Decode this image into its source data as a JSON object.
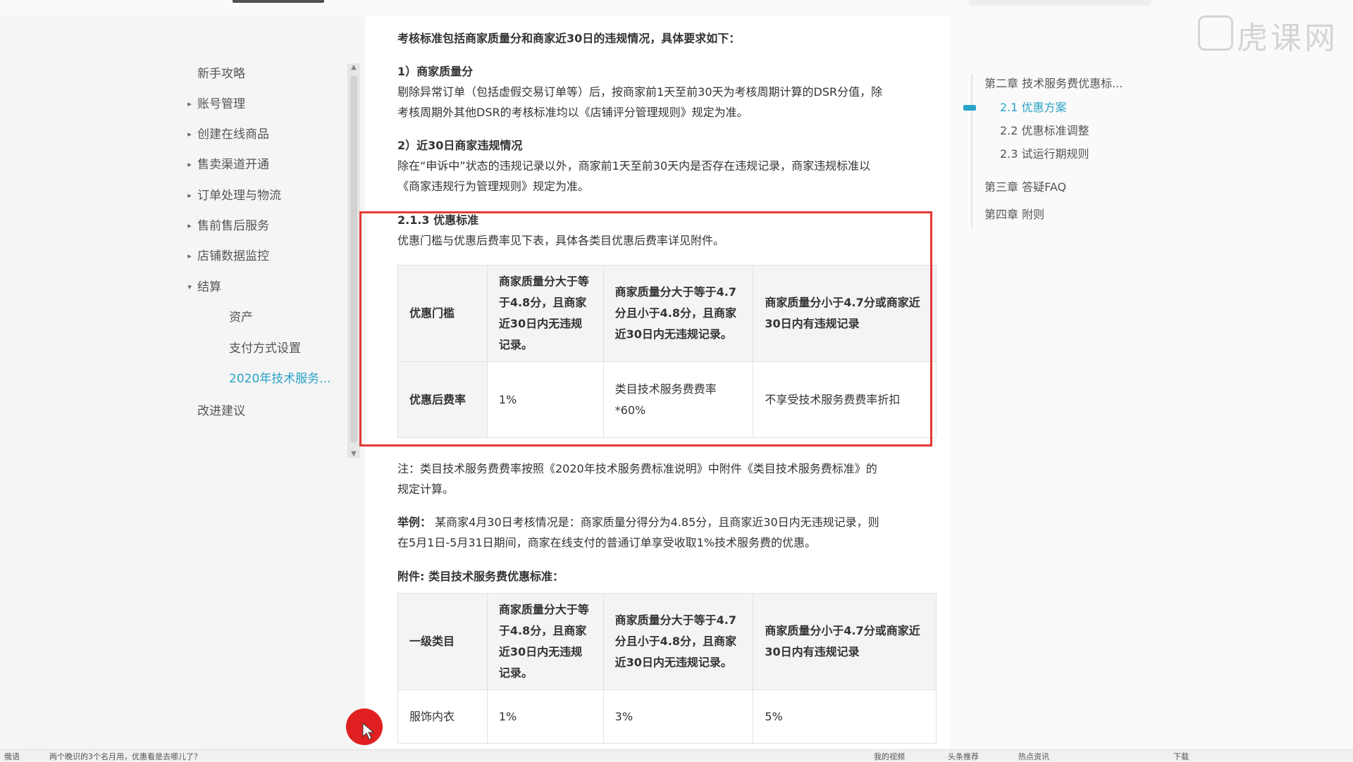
{
  "sidebar": {
    "items": [
      {
        "label": "新手攻略",
        "arrow": ""
      },
      {
        "label": "账号管理",
        "arrow": "▸"
      },
      {
        "label": "创建在线商品",
        "arrow": "▸"
      },
      {
        "label": "售卖渠道开通",
        "arrow": "▸"
      },
      {
        "label": "订单处理与物流",
        "arrow": "▸"
      },
      {
        "label": "售前售后服务",
        "arrow": "▸"
      },
      {
        "label": "店铺数据监控",
        "arrow": "▸"
      },
      {
        "label": "结算",
        "arrow": "▾"
      },
      {
        "label": "资产",
        "arrow": ""
      },
      {
        "label": "支付方式设置",
        "arrow": ""
      },
      {
        "label": "2020年技术服务...",
        "arrow": ""
      },
      {
        "label": "改进建议",
        "arrow": ""
      }
    ]
  },
  "main": {
    "intro": "考核标准包括商家质量分和商家近30日的违规情况，具体要求如下：",
    "s1_title": "1）商家质量分",
    "s1_line1": "剔除异常订单（包括虚假交易订单等）后，按商家前1天至前30天为考核周期计算的DSR分值，除",
    "s1_line2": "考核周期外其他DSR的考核标准均以《店铺评分管理规则》规定为准。",
    "s2_title": "2）近30日商家违规情况",
    "s2_line1": "除在“申诉中”状态的违规记录以外，商家前1天至前30天内是否存在违规记录，商家违规标准以",
    "s2_line2": "《商家违规行为管理规则》规定为准。",
    "s3_title": "2.1.3 优惠标准",
    "s3_desc": "优惠门槛与优惠后费率见下表，具体各类目优惠后费率详见附件。",
    "table1": {
      "head": [
        "优惠门槛",
        "商家质量分大于等于4.8分，且商家近30日内无违规记录。",
        "商家质量分大于等于4.7分且小于4.8分，且商家近30日内无违规记录。",
        "商家质量分小于4.7分或商家近30日内有违规记录"
      ],
      "row": [
        "优惠后费率",
        "1%",
        "类目技术服务费费率*60%",
        "不享受技术服务费费率折扣"
      ]
    },
    "note_line1": "注：类目技术服务费费率按照《2020年技术服务费标准说明》中附件《类目技术服务费标准》的",
    "note_line2": "规定计算。",
    "example_label": "举例：",
    "example_line1": " 某商家4月30日考核情况是：商家质量分得分为4.85分，且商家近30日内无违规记录，则",
    "example_line2": "在5月1日-5月31日期间，商家在线支付的普通订单享受收取1%技术服务费的优惠。",
    "attach_title": "附件: 类目技术服务费优惠标准：",
    "table2": {
      "head": [
        "一级类目",
        "商家质量分大于等于4.8分，且商家近30日内无违规记录。",
        "商家质量分大于等于4.7分且小于4.8分，且商家近30日内无违规记录。",
        "商家质量分小于4.7分或商家近30日内有违规记录"
      ],
      "row": [
        "服饰内衣",
        "1%",
        "3%",
        "5%"
      ]
    }
  },
  "toc": {
    "items": [
      "第二章 技术服务费优惠标...",
      "2.1 优惠方案",
      "2.2 优惠标准调整",
      "2.3 试运行期规则",
      "第三章 答疑FAQ",
      "第四章 附则"
    ]
  },
  "watermark": "虎课网",
  "statusbar": {
    "left": "俄语",
    "mid": "两个晚识的3个名月用，优惠看是去哪儿了？",
    "r1": "我的视频",
    "r2": "头条推荐",
    "r3": "热点资讯",
    "r4": "下载"
  },
  "colors": {
    "accent": "#29a3c7",
    "highlight_box": "#e53935",
    "cursor_dot": "#e02020"
  }
}
